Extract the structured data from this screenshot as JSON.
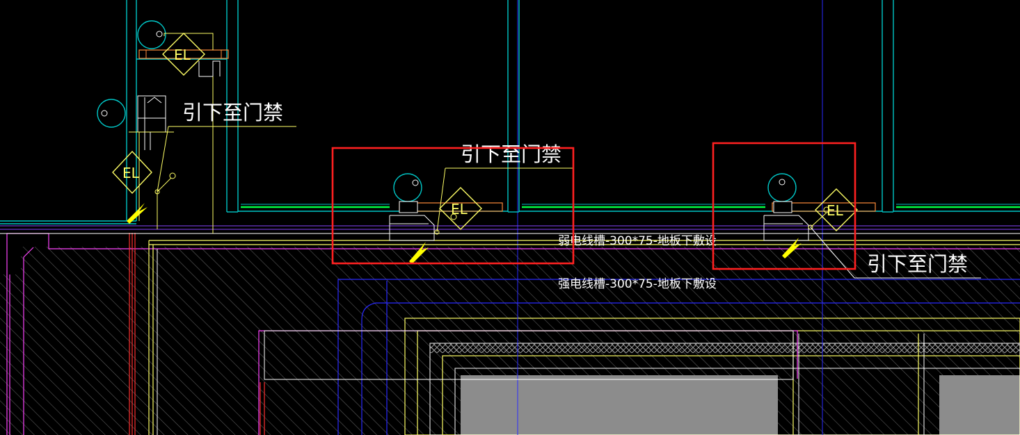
{
  "labels": {
    "lead_down_1": "引下至门禁",
    "lead_down_2": "引下至门禁",
    "lead_down_3": "引下至门禁",
    "weak_trunk": "弱电线槽-300*75-地板下敷设",
    "strong_trunk": "强电线槽-300*75-地板下敷设"
  },
  "symbols": {
    "el_text": "EL"
  },
  "colors": {
    "background": "#000000",
    "cyan": "#00c8c8",
    "yellow": "#ffff66",
    "white": "#ffffff",
    "green": "#00ff44",
    "orange": "#ff8c3a",
    "magenta": "#ff44ff",
    "blue": "#2a2aff",
    "red_highlight": "#ff2020",
    "hatch": "#707070",
    "grey_fill": "#8c8c8c"
  }
}
